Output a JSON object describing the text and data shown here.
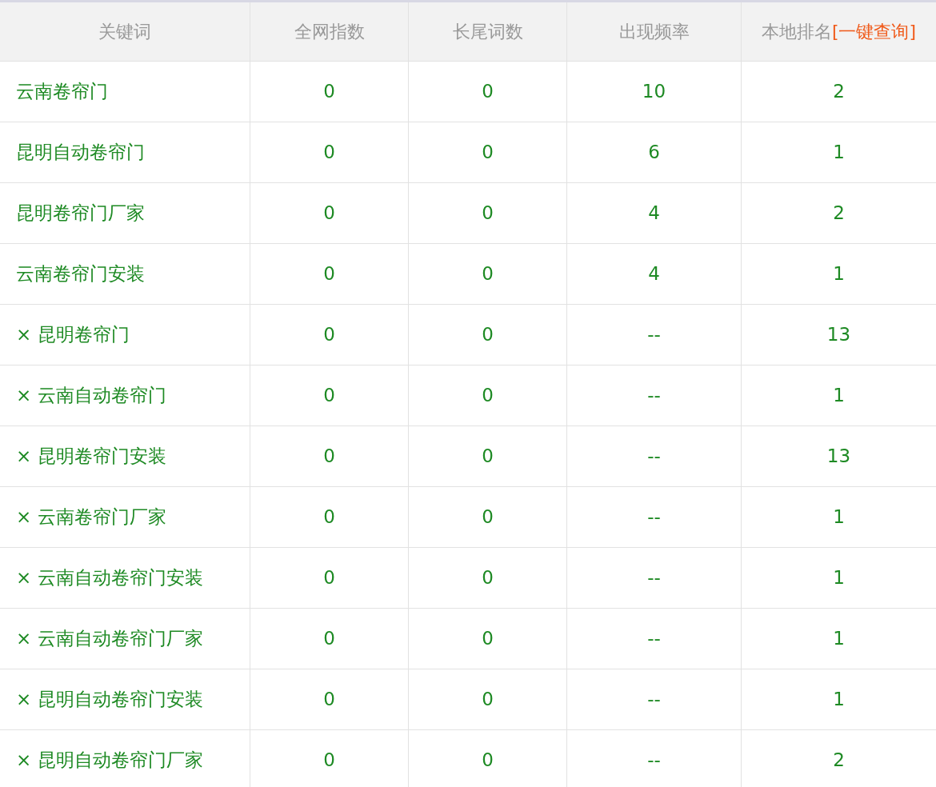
{
  "table": {
    "columns": [
      {
        "label": "关键词"
      },
      {
        "label": "全网指数"
      },
      {
        "label": "长尾词数"
      },
      {
        "label": "出现频率"
      },
      {
        "label": "本地排名",
        "link": "[一键查询]"
      }
    ],
    "rows": [
      [
        "云南卷帘门",
        "0",
        "0",
        "10",
        "2"
      ],
      [
        "昆明自动卷帘门",
        "0",
        "0",
        "6",
        "1"
      ],
      [
        "昆明卷帘门厂家",
        "0",
        "0",
        "4",
        "2"
      ],
      [
        "云南卷帘门安装",
        "0",
        "0",
        "4",
        "1"
      ],
      [
        "× 昆明卷帘门",
        "0",
        "0",
        "--",
        "13"
      ],
      [
        "× 云南自动卷帘门",
        "0",
        "0",
        "--",
        "1"
      ],
      [
        "× 昆明卷帘门安装",
        "0",
        "0",
        "--",
        "13"
      ],
      [
        "× 云南卷帘门厂家",
        "0",
        "0",
        "--",
        "1"
      ],
      [
        "× 云南自动卷帘门安装",
        "0",
        "0",
        "--",
        "1"
      ],
      [
        "× 云南自动卷帘门厂家",
        "0",
        "0",
        "--",
        "1"
      ],
      [
        "× 昆明自动卷帘门安装",
        "0",
        "0",
        "--",
        "1"
      ],
      [
        "× 昆明自动卷帘门厂家",
        "0",
        "0",
        "--",
        "2"
      ]
    ]
  }
}
